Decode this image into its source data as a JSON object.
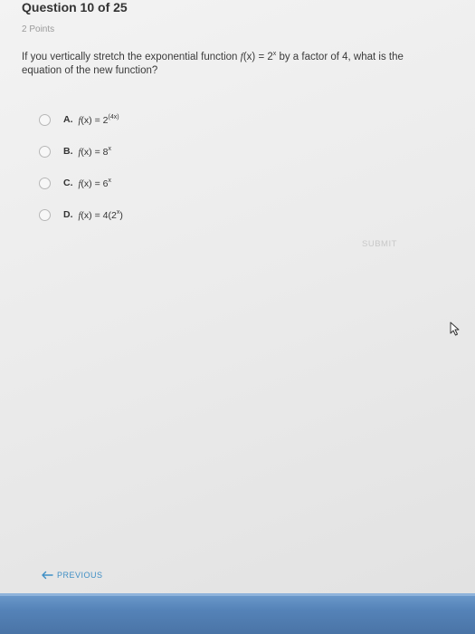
{
  "header": {
    "question_label": "Question 10 of 25",
    "points": "2 Points"
  },
  "question": {
    "prompt_before": "If you vertically stretch the exponential function ",
    "prompt_func": "f",
    "prompt_mid": "(x) = 2",
    "prompt_exp": "x",
    "prompt_after": " by a factor of 4, what is the equation of the new function?"
  },
  "options": [
    {
      "letter": "A.",
      "func": "f",
      "lhs": "(x) = 2",
      "exp": "(4x)",
      "tail": ""
    },
    {
      "letter": "B.",
      "func": "f",
      "lhs": "(x) = 8",
      "exp": "x",
      "tail": ""
    },
    {
      "letter": "C.",
      "func": "f",
      "lhs": "(x) = 6",
      "exp": "x",
      "tail": ""
    },
    {
      "letter": "D.",
      "func": "f",
      "lhs": "(x) = 4(2",
      "exp": "x",
      "tail": ")"
    }
  ],
  "actions": {
    "submit_label": "SUBMIT",
    "previous_label": "PREVIOUS"
  },
  "colors": {
    "link": "#3f8fc5",
    "submit_disabled": "#c8c8c8",
    "bottom_bar": "#5583b8"
  },
  "icons": {
    "previous": "arrow-left-icon",
    "cursor": "mouse-pointer-icon"
  }
}
